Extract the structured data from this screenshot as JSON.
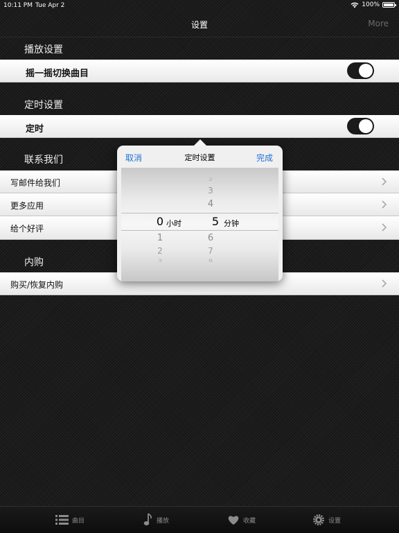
{
  "status_bar": {
    "time": "10:11 PM",
    "date": "Tue Apr 2",
    "battery": "100%"
  },
  "nav": {
    "title": "设置",
    "more": "More"
  },
  "sections": {
    "playback": {
      "header": "播放设置",
      "shake_label": "摇一摇切换曲目",
      "shake_on": true
    },
    "timer": {
      "header": "定时设置",
      "timer_label": "定时",
      "timer_on": true
    },
    "contact": {
      "header": "联系我们",
      "items": [
        "写邮件给我们",
        "更多应用",
        "给个好评"
      ]
    },
    "purchase": {
      "header": "内购",
      "items": [
        "购买/恢复内购"
      ]
    }
  },
  "popover": {
    "cancel": "取消",
    "title": "定时设置",
    "done": "完成",
    "hours": {
      "above": [],
      "selected": "0",
      "below": [
        "1",
        "2",
        "3"
      ],
      "unit": "小时"
    },
    "minutes": {
      "above": [
        "2",
        "3",
        "4"
      ],
      "selected": "5",
      "below": [
        "6",
        "7",
        "8"
      ],
      "unit": "分钟"
    }
  },
  "tab_bar": {
    "items": [
      {
        "label": "曲目",
        "icon": "list-icon"
      },
      {
        "label": "播放",
        "icon": "music-note-icon"
      },
      {
        "label": "收藏",
        "icon": "heart-icon"
      },
      {
        "label": "设置",
        "icon": "gear-icon"
      }
    ]
  },
  "colors": {
    "accent": "#1e72d4",
    "toggle_on": "#1b1b1b",
    "background": "#1c1c1c"
  }
}
